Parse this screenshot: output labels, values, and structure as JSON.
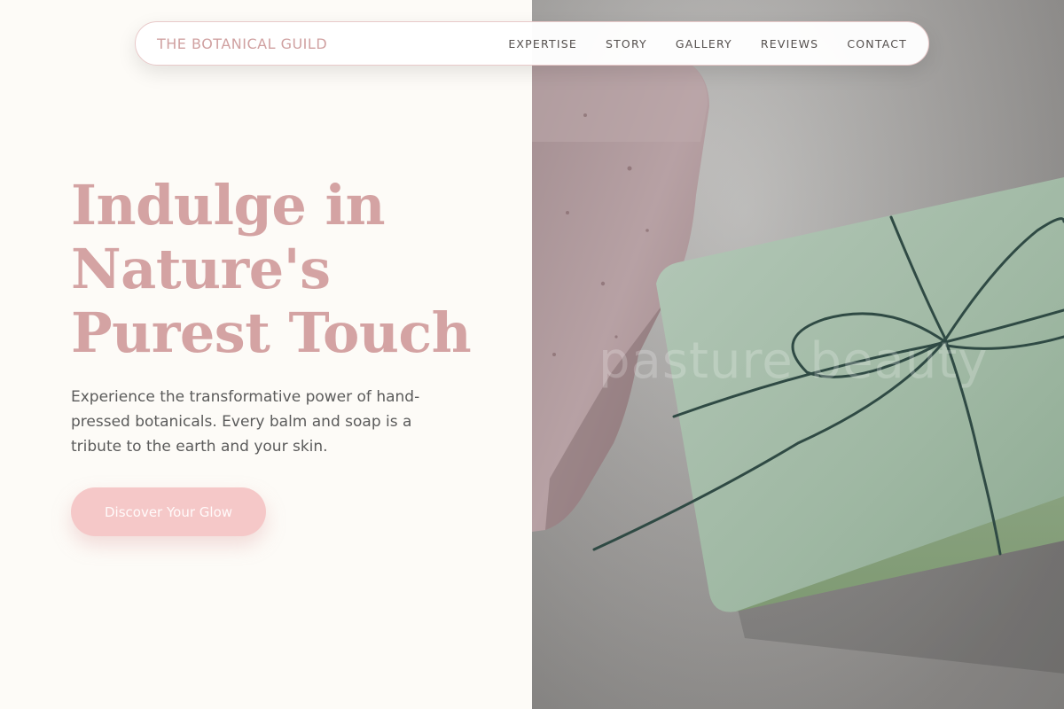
{
  "nav": {
    "brand": "THE BOTANICAL GUILD",
    "links": [
      {
        "label": "EXPERTISE"
      },
      {
        "label": "STORY"
      },
      {
        "label": "GALLERY"
      },
      {
        "label": "REVIEWS"
      },
      {
        "label": "CONTACT"
      }
    ]
  },
  "hero": {
    "headline_lines": [
      "Indulge in",
      "Nature's",
      "Purest Touch"
    ],
    "description": "Experience the transformative power of hand-pressed botanicals. Every balm and soap is a tribute to the earth and your skin.",
    "cta_label": "Discover Your Glow"
  },
  "photo": {
    "watermark": "pasture beauty"
  },
  "colors": {
    "background": "#fdfbf7",
    "accent_rose": "#d4a3a3",
    "cta_pink": "#f5c8c8",
    "body_text": "#5b5b5b",
    "nav_text": "#55504e",
    "soap_green": "#9fb7a0",
    "soap_pink": "#b29c9e",
    "twine": "#2f4a44"
  }
}
